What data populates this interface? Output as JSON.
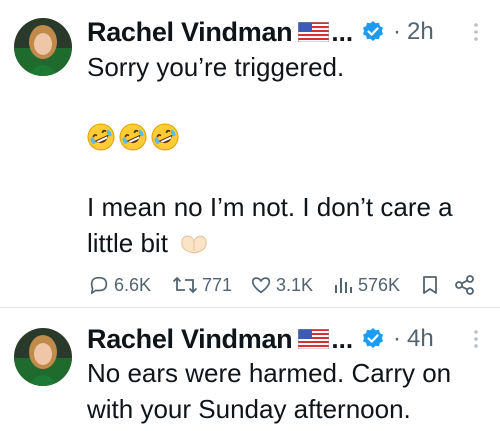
{
  "tweets": [
    {
      "author": "Rachel Vindman",
      "name_truncation": "...",
      "time": "2h",
      "dot": "·",
      "lines": [
        "Sorry you’re triggered.",
        "I mean no I’m not. I don’t care a",
        "little bit"
      ],
      "emoji": [
        "rolling-on-floor-laughing",
        "rolling-on-floor-laughing",
        "rolling-on-floor-laughing"
      ],
      "trailing_emoji": "heart-hands",
      "stats": {
        "replies": "6.6K",
        "reposts": "771",
        "likes": "3.1K",
        "views": "576K"
      }
    },
    {
      "author": "Rachel Vindman",
      "name_truncation": "...",
      "time": "4h",
      "dot": "·",
      "lines": [
        "No ears were harmed. Carry on",
        "with your Sunday afternoon."
      ]
    }
  ],
  "colors": {
    "text": "#0f1419",
    "secondary": "#536471",
    "verified": "#1d9bf0",
    "divider": "#e7e9ea"
  },
  "icons": [
    "avatar",
    "us-flag-icon",
    "verified-badge-icon",
    "more-icon",
    "reply-icon",
    "repost-icon",
    "like-icon",
    "views-icon",
    "bookmark-icon",
    "share-icon"
  ]
}
